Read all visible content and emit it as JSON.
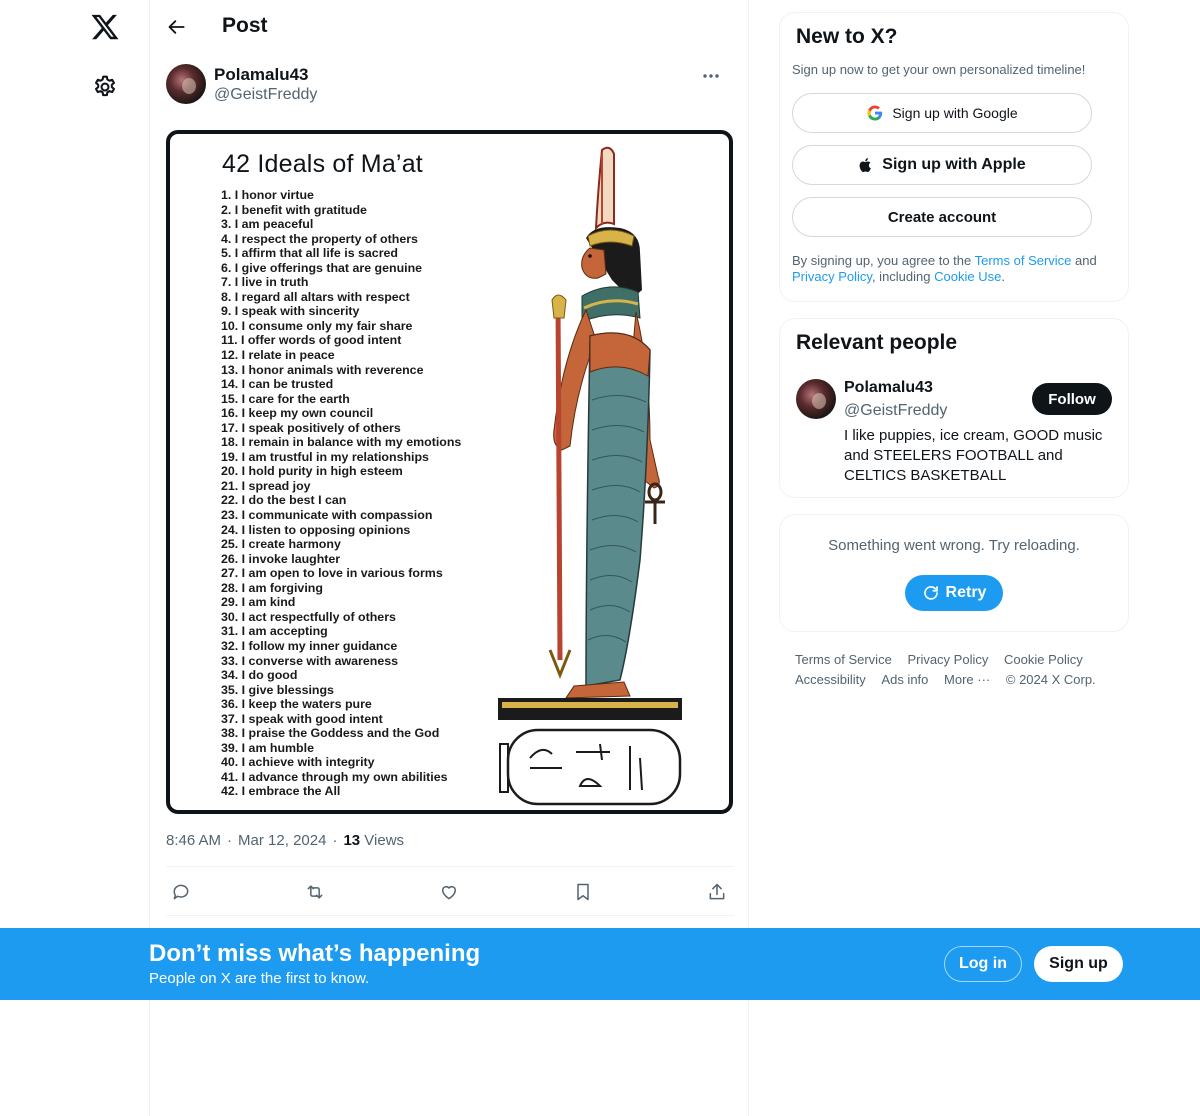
{
  "post_header": {
    "title": "Post"
  },
  "author": {
    "name": "Polamalu43",
    "handle": "@GeistFreddy"
  },
  "media": {
    "title": "42 Ideals of Ma’at",
    "ideals": [
      "1. I honor virtue",
      "2. I benefit with gratitude",
      "3. I am peaceful",
      "4. I respect the property of others",
      "5. I affirm that all life is sacred",
      "6. I give offerings that are genuine",
      "7. I live in truth",
      "8. I regard all altars with respect",
      "9. I speak with sincerity",
      "10. I consume only my fair share",
      "11. I offer words of good intent",
      "12. I relate in peace",
      "13. I honor animals with reverence",
      "14. I can be trusted",
      "15. I care for the earth",
      "16. I keep my own council",
      "17. I speak positively of others",
      "18. I remain in balance with my emotions",
      "19. I am trustful in my relationships",
      "20. I hold purity in high esteem",
      "21. I spread joy",
      "22. I do the best I can",
      "23. I communicate with compassion",
      "24. I listen to opposing opinions",
      "25. I create harmony",
      "26. I invoke laughter",
      "27. I am open to love in various forms",
      "28. I am forgiving",
      "29. I am kind",
      "30. I act respectfully of others",
      "31. I am accepting",
      "32. I follow my inner guidance",
      "33. I converse with awareness",
      "34. I do good",
      "35. I give blessings",
      "36. I keep the waters pure",
      "37. I speak with good intent",
      "38. I praise the Goddess and the God",
      "39. I am humble",
      "40. I achieve with integrity",
      "41. I advance through my own abilities",
      "42. I embrace the All"
    ]
  },
  "meta": {
    "time": "8:46 AM",
    "date": "Mar 12, 2024",
    "views_count": "13",
    "views_label": "Views",
    "separator": "·"
  },
  "new_to_x": {
    "title": "New to X?",
    "subtitle": "Sign up now to get your own personalized timeline!",
    "google_label": "Sign up with Google",
    "apple_label": "Sign up with Apple",
    "create_label": "Create account",
    "legal_prefix": "By signing up, you agree to the ",
    "terms_link": "Terms of Service",
    "legal_and": " and ",
    "privacy_link": "Privacy Policy",
    "legal_including": ", including ",
    "cookie_link": "Cookie Use",
    "legal_end": "."
  },
  "relevant_people": {
    "title": "Relevant people",
    "name": "Polamalu43",
    "handle": "@GeistFreddy",
    "follow_label": "Follow",
    "bio": "I like puppies, ice cream, GOOD music and STEELERS FOOTBALL and CELTICS BASKETBALL"
  },
  "error_card": {
    "message": "Something went wrong. Try reloading.",
    "retry_label": "Retry"
  },
  "footer": {
    "links": [
      "Terms of Service",
      "Privacy Policy",
      "Cookie Policy",
      "Accessibility",
      "Ads info",
      "More ···",
      "© 2024 X Corp."
    ]
  },
  "bottom_bar": {
    "title": "Don’t miss what’s happening",
    "subtitle": "People on X are the first to know.",
    "login_label": "Log in",
    "signup_label": "Sign up"
  },
  "icons": {
    "logo": "x-logo-icon",
    "settings": "gear-icon",
    "back": "arrow-left-icon",
    "more": "more-dots-icon",
    "reply": "reply-icon",
    "repost": "repost-icon",
    "like": "heart-icon",
    "bookmark": "bookmark-icon",
    "share": "share-icon",
    "google": "google-icon",
    "apple": "apple-icon",
    "retry": "refresh-icon"
  },
  "colors": {
    "accent": "#1d9bf0",
    "text": "#0f1419",
    "muted": "#536471",
    "border": "#eff3f4"
  }
}
